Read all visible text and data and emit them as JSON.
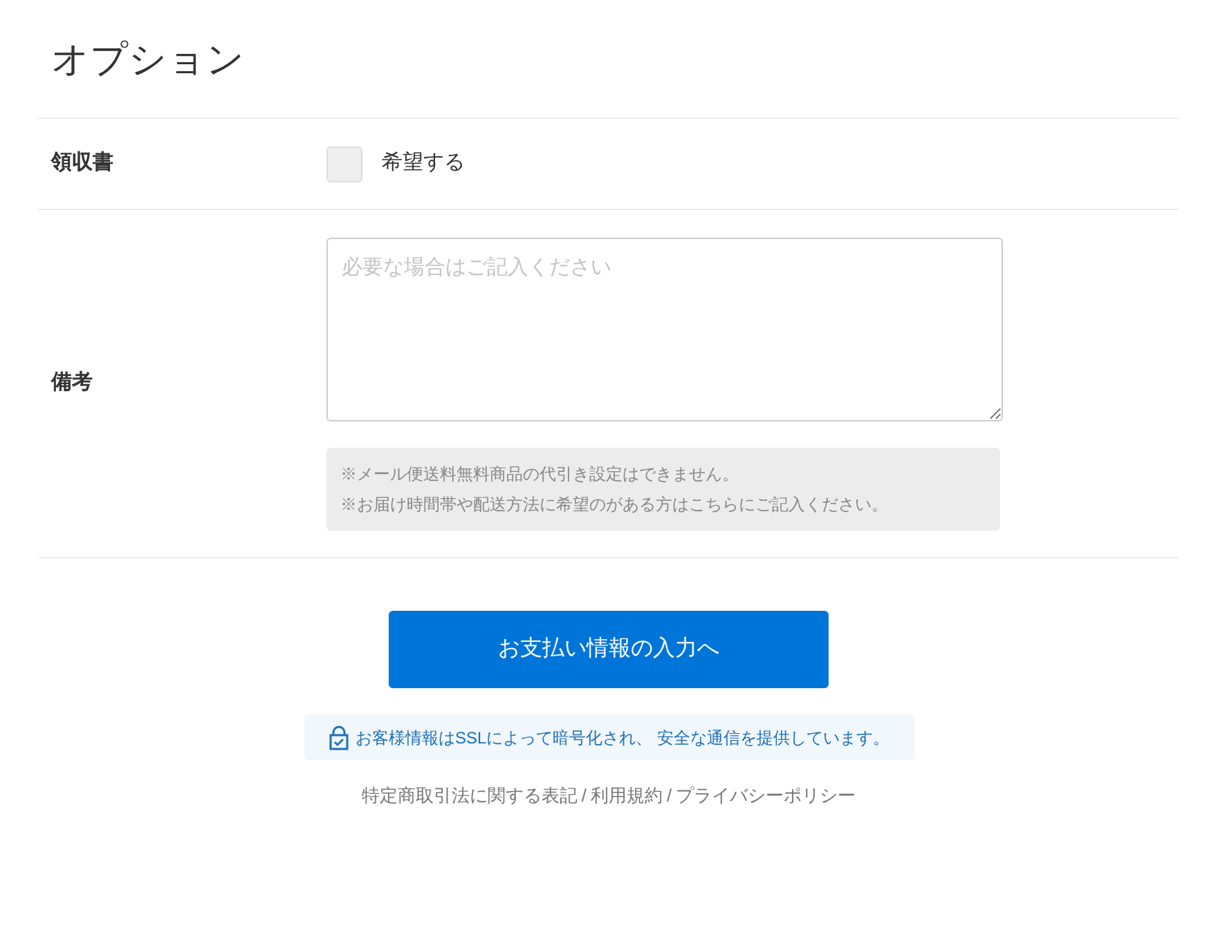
{
  "title": "オプション",
  "receipt": {
    "label": "領収書",
    "checkbox_label": "希望する",
    "checked": false
  },
  "remarks": {
    "label": "備考",
    "placeholder": "必要な場合はご記入ください",
    "notes": [
      "※メール便送料無料商品の代引き設定はできません。",
      "※お届け時間帯や配送方法に希望のがある方はこちらにご記入ください。"
    ]
  },
  "submit_button": "お支払い情報の入力へ",
  "ssl_notice": "お客様情報はSSLによって暗号化され、 安全な通信を提供しています。",
  "footer_links": [
    {
      "label": "特定商取引法に関する表記"
    },
    {
      "label": "利用規約"
    },
    {
      "label": "プライバシーポリシー"
    }
  ],
  "footer_separator": "/"
}
